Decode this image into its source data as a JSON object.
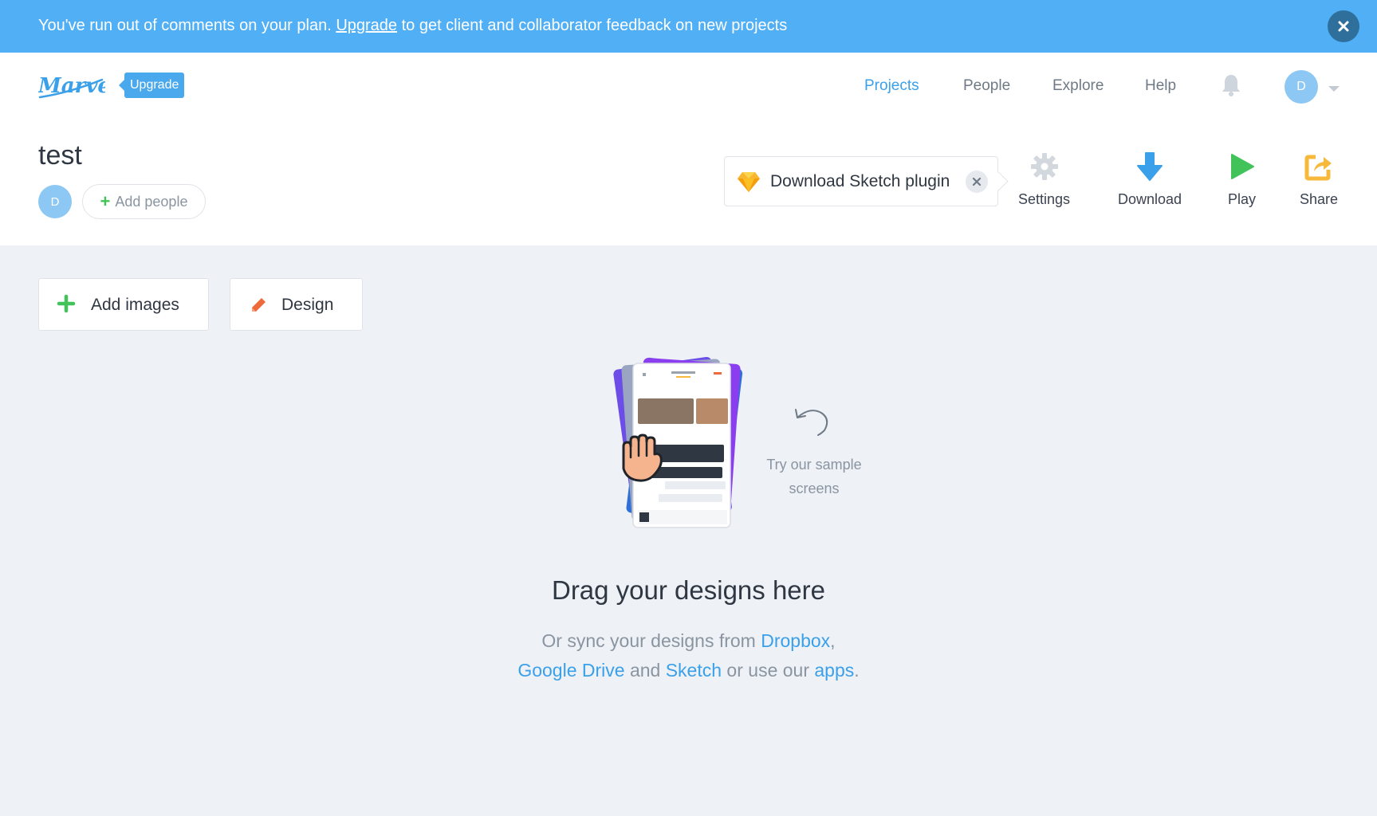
{
  "banner": {
    "text_before": "You've run out of comments on your plan. ",
    "link": "Upgrade",
    "text_after": " to get client and collaborator feedback on new projects"
  },
  "header": {
    "logo": "Marvel",
    "upgrade_badge": "Upgrade",
    "nav": [
      "Projects",
      "People",
      "Explore",
      "Help"
    ],
    "active_nav": "Projects",
    "avatar_initial": "D"
  },
  "project": {
    "title": "test",
    "member_initial": "D",
    "add_people_label": "Add people"
  },
  "sketch_plugin": {
    "label": "Download Sketch plugin"
  },
  "toolbar": {
    "settings": "Settings",
    "download": "Download",
    "play": "Play",
    "share": "Share"
  },
  "actions": {
    "add_images": "Add images",
    "design": "Design"
  },
  "empty_state": {
    "sample_hint": "Try our sample screens",
    "title": "Drag your designs here",
    "sync_prefix": "Or sync your designs from ",
    "dropbox": "Dropbox",
    "comma": ",",
    "google_drive": "Google Drive",
    "and": " and ",
    "sketch": "Sketch",
    "or_use": " or use our ",
    "apps": "apps",
    "period": "."
  },
  "colors": {
    "banner": "#50aff5",
    "accent": "#3aa0ea",
    "green": "#41c35a",
    "background": "#eef1f5"
  },
  "icons": [
    "close-icon",
    "marvel-logo",
    "bell-icon",
    "chevron-down-icon",
    "plus-icon",
    "sketch-gem-icon",
    "gear-icon",
    "download-arrow-icon",
    "play-icon",
    "share-icon",
    "pencil-icon",
    "curved-arrow-icon",
    "hand-icon"
  ]
}
